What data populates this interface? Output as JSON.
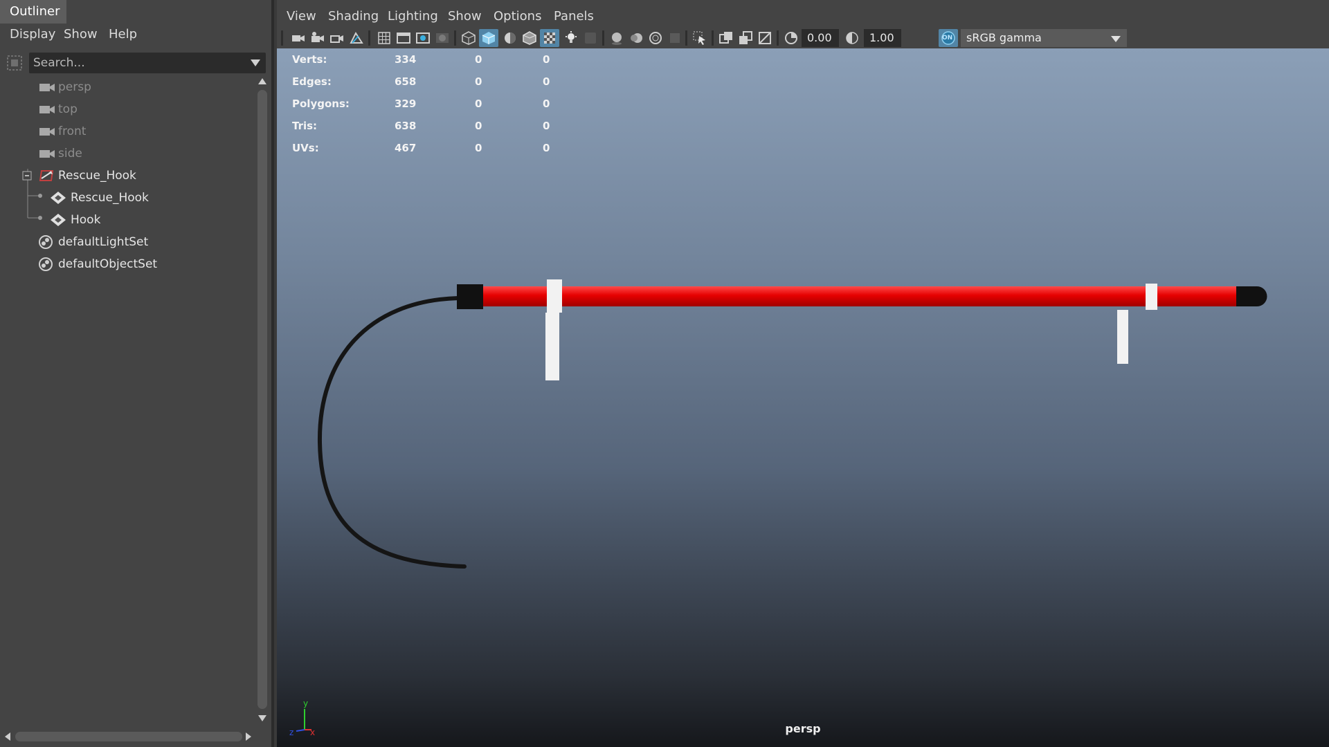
{
  "outliner": {
    "tab_title": "Outliner",
    "menu": [
      "Display",
      "Show",
      "Help"
    ],
    "search_placeholder": "Search...",
    "items": [
      {
        "label": "persp",
        "icon": "camera-icon",
        "state": "dim"
      },
      {
        "label": "top",
        "icon": "camera-icon",
        "state": "dim"
      },
      {
        "label": "front",
        "icon": "camera-icon",
        "state": "dim"
      },
      {
        "label": "side",
        "icon": "camera-icon",
        "state": "dim"
      },
      {
        "label": "Rescue_Hook",
        "icon": "group-transform-icon",
        "state": "expanded"
      },
      {
        "label": "Rescue_Hook",
        "icon": "mesh-icon",
        "state": "child"
      },
      {
        "label": "Hook",
        "icon": "mesh-icon",
        "state": "child"
      },
      {
        "label": "defaultLightSet",
        "icon": "set-icon",
        "state": "normal"
      },
      {
        "label": "defaultObjectSet",
        "icon": "set-icon",
        "state": "normal"
      }
    ]
  },
  "viewport": {
    "menu": [
      "View",
      "Shading",
      "Lighting",
      "Show",
      "Options",
      "Panels"
    ],
    "exposure": "0.00",
    "gamma": "1.00",
    "color_management": "sRGB gamma",
    "color_management_toggle": "ON",
    "camera_label": "persp",
    "hud": [
      {
        "label": "Verts:",
        "values": [
          "334",
          "0",
          "0"
        ]
      },
      {
        "label": "Edges:",
        "values": [
          "658",
          "0",
          "0"
        ]
      },
      {
        "label": "Polygons:",
        "values": [
          "329",
          "0",
          "0"
        ]
      },
      {
        "label": "Tris:",
        "values": [
          "638",
          "0",
          "0"
        ]
      },
      {
        "label": "UVs:",
        "values": [
          "467",
          "0",
          "0"
        ]
      }
    ],
    "axis_labels": {
      "y": "y",
      "x": "x",
      "z": "z"
    }
  },
  "colors": {
    "shaft": "#e60000",
    "cap": "#111111",
    "hook": "#151515",
    "clip": "#f2f2f2"
  }
}
